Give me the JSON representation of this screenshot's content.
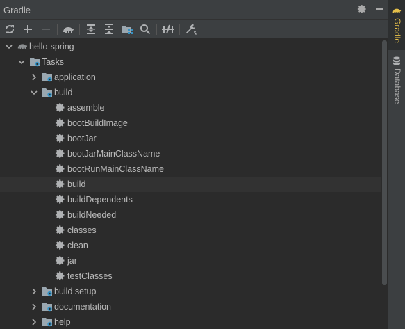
{
  "header": {
    "title": "Gradle",
    "settings_icon": "gear-icon",
    "minimize_icon": "minimize-icon"
  },
  "toolbar": {
    "buttons": [
      {
        "name": "reload-all-button",
        "icon": "refresh-icon"
      },
      {
        "name": "add-project-button",
        "icon": "plus-icon"
      },
      {
        "name": "remove-project-button",
        "icon": "minus-icon"
      },
      {
        "name": "execute-task-button",
        "icon": "elephant-icon"
      },
      {
        "name": "expand-all-button",
        "icon": "expand-all-icon"
      },
      {
        "name": "collapse-all-button",
        "icon": "collapse-all-icon"
      },
      {
        "name": "group-modules-button",
        "icon": "folder-grid-icon"
      },
      {
        "name": "search-button",
        "icon": "search-icon"
      },
      {
        "name": "toggle-offline-button",
        "icon": "offline-icon"
      },
      {
        "name": "build-tool-settings-button",
        "icon": "wrench-icon"
      }
    ]
  },
  "tree": [
    {
      "label": "hello-spring",
      "level": 0,
      "expanded": true,
      "type": "project"
    },
    {
      "label": "Tasks",
      "level": 1,
      "expanded": true,
      "type": "folder"
    },
    {
      "label": "application",
      "level": 2,
      "expanded": false,
      "type": "folder"
    },
    {
      "label": "build",
      "level": 2,
      "expanded": true,
      "type": "folder"
    },
    {
      "label": "assemble",
      "level": 3,
      "type": "task"
    },
    {
      "label": "bootBuildImage",
      "level": 3,
      "type": "task"
    },
    {
      "label": "bootJar",
      "level": 3,
      "type": "task"
    },
    {
      "label": "bootJarMainClassName",
      "level": 3,
      "type": "task"
    },
    {
      "label": "bootRunMainClassName",
      "level": 3,
      "type": "task"
    },
    {
      "label": "build",
      "level": 3,
      "type": "task",
      "selected": true
    },
    {
      "label": "buildDependents",
      "level": 3,
      "type": "task"
    },
    {
      "label": "buildNeeded",
      "level": 3,
      "type": "task"
    },
    {
      "label": "classes",
      "level": 3,
      "type": "task"
    },
    {
      "label": "clean",
      "level": 3,
      "type": "task"
    },
    {
      "label": "jar",
      "level": 3,
      "type": "task"
    },
    {
      "label": "testClasses",
      "level": 3,
      "type": "task"
    },
    {
      "label": "build setup",
      "level": 2,
      "expanded": false,
      "type": "folder"
    },
    {
      "label": "documentation",
      "level": 2,
      "expanded": false,
      "type": "folder"
    },
    {
      "label": "help",
      "level": 2,
      "expanded": false,
      "type": "folder"
    }
  ],
  "side_tabs": [
    {
      "label": "Gradle",
      "icon": "elephant-icon",
      "active": true
    },
    {
      "label": "Database",
      "icon": "database-icon",
      "active": false
    }
  ],
  "colors": {
    "accent": "#3592c4",
    "active_tab_text": "#e6c04a",
    "text": "#bbbbbb"
  }
}
